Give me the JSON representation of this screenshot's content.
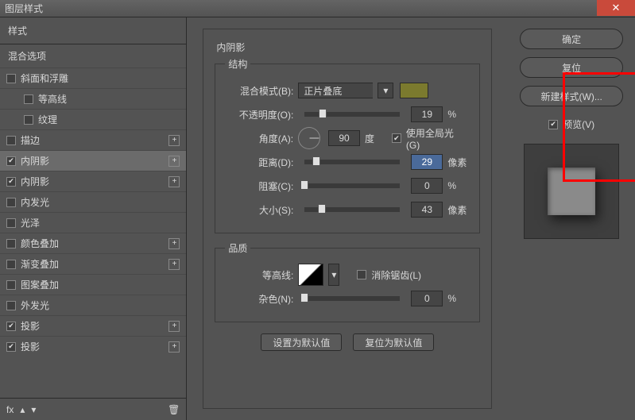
{
  "window": {
    "title": "图层样式"
  },
  "left": {
    "header": "样式",
    "blend": "混合选项",
    "items": [
      {
        "label": "斜面和浮雕",
        "checked": false,
        "plus": false,
        "sub": false
      },
      {
        "label": "等高线",
        "checked": false,
        "plus": false,
        "sub": true
      },
      {
        "label": "纹理",
        "checked": false,
        "plus": false,
        "sub": true
      },
      {
        "label": "描边",
        "checked": false,
        "plus": true,
        "sub": false
      },
      {
        "label": "内阴影",
        "checked": true,
        "plus": true,
        "sub": false,
        "active": true
      },
      {
        "label": "内阴影",
        "checked": true,
        "plus": true,
        "sub": false
      },
      {
        "label": "内发光",
        "checked": false,
        "plus": false,
        "sub": false
      },
      {
        "label": "光泽",
        "checked": false,
        "plus": false,
        "sub": false
      },
      {
        "label": "颜色叠加",
        "checked": false,
        "plus": true,
        "sub": false
      },
      {
        "label": "渐变叠加",
        "checked": false,
        "plus": true,
        "sub": false
      },
      {
        "label": "图案叠加",
        "checked": false,
        "plus": false,
        "sub": false
      },
      {
        "label": "外发光",
        "checked": false,
        "plus": false,
        "sub": false
      },
      {
        "label": "投影",
        "checked": true,
        "plus": true,
        "sub": false
      },
      {
        "label": "投影",
        "checked": true,
        "plus": true,
        "sub": false
      }
    ],
    "fx": "fx"
  },
  "panel": {
    "title": "内阴影",
    "group_struct": "结构",
    "blend_mode_label": "混合模式(B):",
    "blend_mode_value": "正片叠底",
    "swatch_color": "#7b7a2e",
    "opacity_label": "不透明度(O):",
    "opacity_value": "19",
    "opacity_unit": "%",
    "angle_label": "角度(A):",
    "angle_value": "90",
    "angle_unit": "度",
    "global_light": "使用全局光 (G)",
    "distance_label": "距离(D):",
    "distance_value": "29",
    "distance_unit": "像素",
    "choke_label": "阻塞(C):",
    "choke_value": "0",
    "choke_unit": "%",
    "size_label": "大小(S):",
    "size_value": "43",
    "size_unit": "像素",
    "group_quality": "品质",
    "contour_label": "等高线:",
    "antialias": "消除锯齿(L)",
    "noise_label": "杂色(N):",
    "noise_value": "0",
    "noise_unit": "%",
    "btn_default": "设置为默认值",
    "btn_reset": "复位为默认值"
  },
  "right": {
    "ok": "确定",
    "cancel": "复位",
    "newstyle": "新建样式(W)...",
    "preview": "预览(V)"
  }
}
